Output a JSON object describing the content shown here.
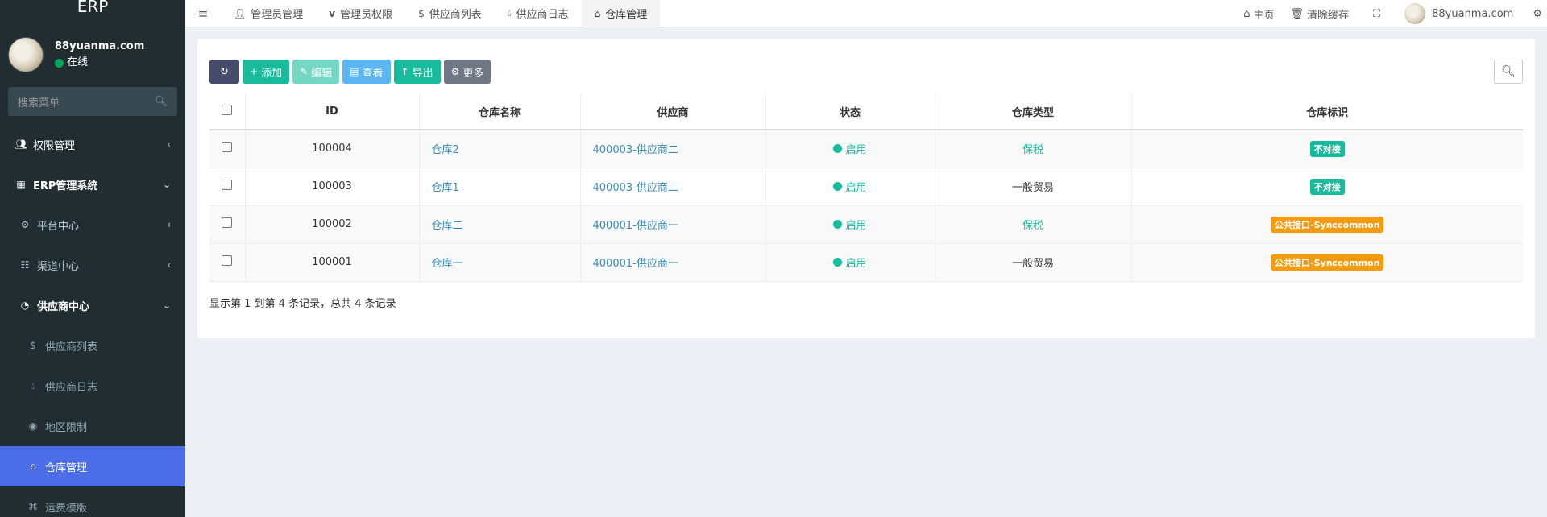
{
  "app": {
    "logo": "ERP"
  },
  "user": {
    "name": "88yuanma.com",
    "status": "在线"
  },
  "sidebar": {
    "search_placeholder": "搜索菜单",
    "items": [
      {
        "label": "权限管理",
        "icon": "users-icon"
      },
      {
        "label": "ERP管理系统",
        "icon": "table-icon"
      },
      {
        "label": "平台中心",
        "icon": "gear-icon"
      },
      {
        "label": "渠道中心",
        "icon": "sitemap-icon"
      },
      {
        "label": "供应商中心",
        "icon": "dashboard-icon"
      },
      {
        "label": "供应商列表",
        "icon": "dollar-icon"
      },
      {
        "label": "供应商日志",
        "icon": "drop-icon"
      },
      {
        "label": "地区限制",
        "icon": "globe-icon"
      },
      {
        "label": "仓库管理",
        "icon": "home-icon"
      },
      {
        "label": "运费模版",
        "icon": "puzzle-icon"
      }
    ]
  },
  "navbar": {
    "tabs": [
      {
        "label": "管理员管理",
        "icon": "user-icon"
      },
      {
        "label": "管理员权限",
        "icon": "vimeo-icon"
      },
      {
        "label": "供应商列表",
        "icon": "dollar-icon"
      },
      {
        "label": "供应商日志",
        "icon": "drop-icon"
      },
      {
        "label": "仓库管理",
        "icon": "home-icon"
      }
    ],
    "home": "主页",
    "clear_cache": "清除缓存",
    "username": "88yuanma.com"
  },
  "toolbar": {
    "add": "添加",
    "edit": "编辑",
    "view": "查看",
    "export": "导出",
    "more": "更多"
  },
  "table": {
    "headers": [
      "ID",
      "仓库名称",
      "供应商",
      "状态",
      "仓库类型",
      "仓库标识"
    ],
    "rows": [
      {
        "id": "100004",
        "name": "仓库2",
        "supplier": "400003-供应商二",
        "status": "启用",
        "type": "保税",
        "tag": "不对接"
      },
      {
        "id": "100003",
        "name": "仓库1",
        "supplier": "400003-供应商二",
        "status": "启用",
        "type": "一般贸易",
        "tag": "不对接"
      },
      {
        "id": "100002",
        "name": "仓库二",
        "supplier": "400001-供应商一",
        "status": "启用",
        "type": "保税",
        "tag": "公共接口-Synccommon"
      },
      {
        "id": "100001",
        "name": "仓库一",
        "supplier": "400001-供应商一",
        "status": "启用",
        "type": "一般贸易",
        "tag": "公共接口-Synccommon"
      }
    ]
  },
  "pager": {
    "summary": "显示第 1 到第 4 条记录，总共 4 条记录"
  },
  "colors": {
    "sidebar_bg": "#222d32",
    "active_menu": "#4b6ee8",
    "success": "#18bc9c",
    "warning": "#f39c12",
    "link": "#3c8dbc"
  }
}
